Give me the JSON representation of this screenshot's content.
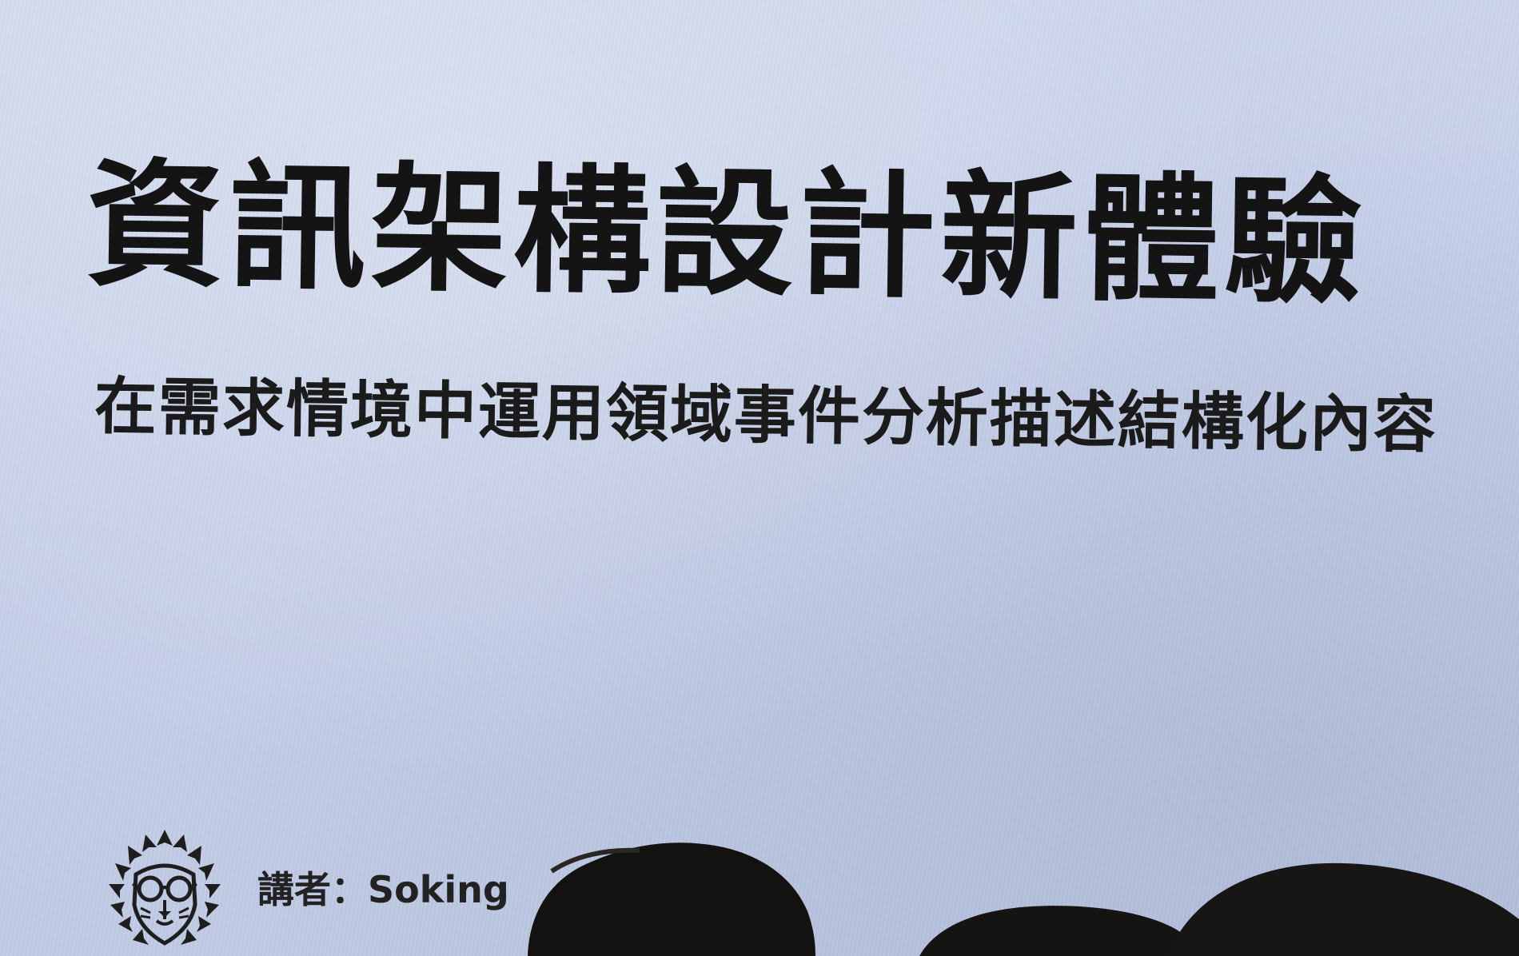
{
  "slide": {
    "title": "資訊架構設計新體驗",
    "subtitle": "在需求情境中運用領域事件分析描述結構化內容",
    "speaker": "講者：Soking"
  },
  "icons": {
    "logo": "lion-with-glasses-icon"
  },
  "colors": {
    "screen_background": "#c9d3ea",
    "text": "#141414"
  }
}
